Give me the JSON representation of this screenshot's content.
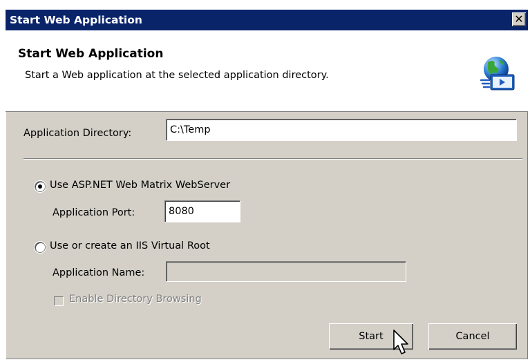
{
  "window": {
    "title": "Start Web Application",
    "close_glyph": "✕"
  },
  "header": {
    "title": "Start Web Application",
    "subtitle": "Start a Web application at the selected application directory.",
    "icon": "globe-app-icon"
  },
  "form": {
    "app_dir_label": "Application Directory:",
    "app_dir_value": "C:\\Temp",
    "option_webmatrix_label": "Use ASP.NET Web Matrix WebServer",
    "option_webmatrix_selected": true,
    "app_port_label": "Application Port:",
    "app_port_value": "8080",
    "option_iis_label": "Use or create an IIS Virtual Root",
    "option_iis_selected": false,
    "app_name_label": "Application Name:",
    "app_name_value": "",
    "enable_browsing_label": "Enable Directory Browsing",
    "enable_browsing_checked": false
  },
  "buttons": {
    "start_label": "Start",
    "cancel_label": "Cancel"
  },
  "colors": {
    "titlebar": "#0a246a",
    "dialog_bg": "#d4d0c8",
    "header_bg": "#ffffff"
  }
}
